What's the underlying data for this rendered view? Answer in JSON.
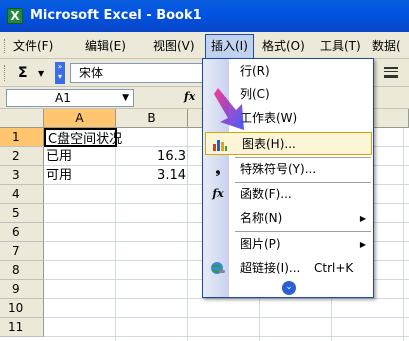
{
  "window": {
    "title": "Microsoft Excel - Book1",
    "app_icon": "excel-icon"
  },
  "menubar": {
    "items": [
      "文件(F)",
      "编辑(E)",
      "视图(V)",
      "插入(I)",
      "格式(O)",
      "工具(T)",
      "数据("
    ],
    "active": "插入(I)"
  },
  "toolbar": {
    "sum_label": "Σ",
    "font_name": "宋体",
    "align_icon": "align-center-icon"
  },
  "formula_bar": {
    "name_box": "A1",
    "fx_label": "fx"
  },
  "sheet": {
    "columns": [
      "A",
      "B"
    ],
    "rows": [
      "1",
      "2",
      "3",
      "4",
      "5",
      "6",
      "7",
      "8",
      "9",
      "10",
      "11"
    ],
    "cells": {
      "A1": "C盘空间状况",
      "A2": "已用",
      "B2": "16.3",
      "A3": "可用",
      "B3": "3.14"
    }
  },
  "insert_menu": {
    "items": [
      {
        "label": "行(R)",
        "icon": ""
      },
      {
        "label": "列(C)",
        "icon": ""
      },
      {
        "label": "工作表(W)",
        "icon": ""
      },
      {
        "label": "图表(H)...",
        "icon": "chart-icon",
        "highlighted": true
      },
      {
        "label": "特殊符号(Y)...",
        "icon": "symbol-icon"
      },
      {
        "label": "函数(F)...",
        "icon": "function-icon"
      },
      {
        "label": "名称(N)",
        "icon": "",
        "submenu": true
      },
      {
        "label": "图片(P)",
        "icon": "",
        "submenu": true
      },
      {
        "label": "超链接(I)...",
        "icon": "hyperlink-icon",
        "shortcut": "Ctrl+K"
      }
    ],
    "expand_icon": "expand-chevrons-icon"
  }
}
